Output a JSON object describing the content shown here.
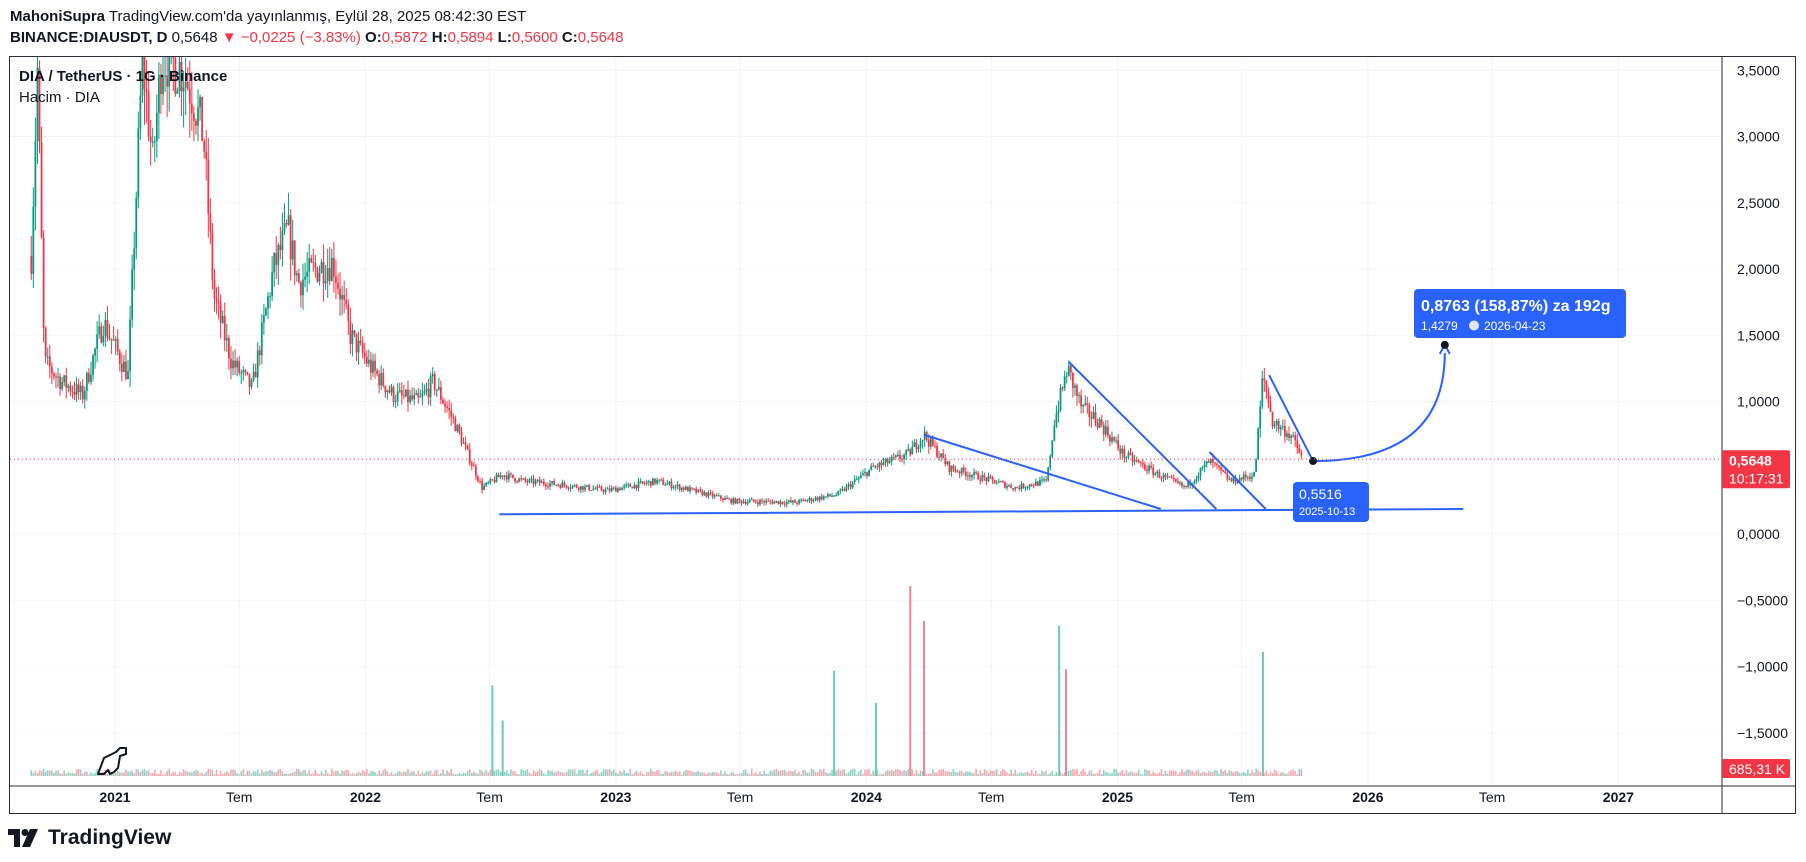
{
  "header": {
    "author": "MahoniSupra",
    "published": "TradingView.com'da yayınlanmış, Eylül 28, 2025 08:42:30 EST",
    "symbol": "BINANCE:DIAUSDT, D",
    "last": "0,5648",
    "change": "−0,0225 (−3.83%)",
    "o_label": "O:",
    "o": "0,5872",
    "h_label": "H:",
    "h": "0,5894",
    "l_label": "L:",
    "l": "0,5600",
    "c_label": "C:",
    "c": "0,5648"
  },
  "legend": {
    "title": "DIA / TetherUS · 1G · Binance",
    "volume": "Hacim · DIA"
  },
  "brand": "TradingView",
  "colors": {
    "up": "#089981",
    "down": "#f23645",
    "drawing": "#2962ff",
    "label_bg": "#2962ff",
    "price_tag": "#f23645"
  },
  "icons": [
    "dinosaur-icon",
    "tradingview-logo-icon",
    "clock-icon"
  ],
  "chart_data": {
    "type": "candlestick",
    "title": "DIA / TetherUS · 1G · Binance",
    "y_axis": {
      "range": [
        -1.9,
        3.6
      ],
      "ticks": [
        {
          "v": 3.5,
          "t": "3,5000"
        },
        {
          "v": 3.0,
          "t": "3,0000"
        },
        {
          "v": 2.5,
          "t": "2,5000"
        },
        {
          "v": 2.0,
          "t": "2,0000"
        },
        {
          "v": 1.5,
          "t": "1,5000"
        },
        {
          "v": 1.0,
          "t": "1,0000"
        },
        {
          "v": 0.0,
          "t": "0,0000"
        },
        {
          "v": -0.5,
          "t": "−0,5000"
        },
        {
          "v": -1.0,
          "t": "−1,0000"
        },
        {
          "v": -1.5,
          "t": "−1,5000"
        }
      ]
    },
    "x_axis": {
      "range": [
        "2020-08-01",
        "2027-06-01"
      ],
      "ticks": [
        {
          "d": "2021-01-01",
          "t": "2021",
          "bold": true
        },
        {
          "d": "2021-07-01",
          "t": "Tem",
          "bold": false
        },
        {
          "d": "2022-01-01",
          "t": "2022",
          "bold": true
        },
        {
          "d": "2022-07-01",
          "t": "Tem",
          "bold": false
        },
        {
          "d": "2023-01-01",
          "t": "2023",
          "bold": true
        },
        {
          "d": "2023-07-01",
          "t": "Tem",
          "bold": false
        },
        {
          "d": "2024-01-01",
          "t": "2024",
          "bold": true
        },
        {
          "d": "2024-07-01",
          "t": "Tem",
          "bold": false
        },
        {
          "d": "2025-01-01",
          "t": "2025",
          "bold": true
        },
        {
          "d": "2025-07-01",
          "t": "Tem",
          "bold": false
        },
        {
          "d": "2026-01-01",
          "t": "2026",
          "bold": true
        },
        {
          "d": "2026-07-01",
          "t": "Tem",
          "bold": false
        },
        {
          "d": "2027-01-01",
          "t": "2027",
          "bold": true
        }
      ]
    },
    "price_path": [
      [
        "2020-09-01",
        2.1
      ],
      [
        "2020-09-10",
        3.5
      ],
      [
        "2020-09-20",
        1.3
      ],
      [
        "2020-10-15",
        1.15
      ],
      [
        "2020-11-15",
        1.05
      ],
      [
        "2020-12-15",
        1.6
      ],
      [
        "2021-01-20",
        1.2
      ],
      [
        "2021-02-10",
        3.6
      ],
      [
        "2021-02-25",
        2.8
      ],
      [
        "2021-03-10",
        3.6
      ],
      [
        "2021-04-10",
        3.5
      ],
      [
        "2021-04-25",
        3.3
      ],
      [
        "2021-05-10",
        3.0
      ],
      [
        "2021-05-25",
        1.8
      ],
      [
        "2021-06-20",
        1.3
      ],
      [
        "2021-07-20",
        1.1
      ],
      [
        "2021-08-20",
        2.0
      ],
      [
        "2021-09-10",
        2.3
      ],
      [
        "2021-09-25",
        1.9
      ],
      [
        "2021-10-20",
        2.0
      ],
      [
        "2021-11-15",
        2.05
      ],
      [
        "2021-12-10",
        1.5
      ],
      [
        "2022-01-10",
        1.25
      ],
      [
        "2022-02-10",
        1.05
      ],
      [
        "2022-03-20",
        1.0
      ],
      [
        "2022-04-10",
        1.15
      ],
      [
        "2022-05-10",
        0.85
      ],
      [
        "2022-06-20",
        0.35
      ],
      [
        "2022-07-20",
        0.45
      ],
      [
        "2022-08-20",
        0.4
      ],
      [
        "2022-10-20",
        0.37
      ],
      [
        "2022-12-20",
        0.33
      ],
      [
        "2023-03-01",
        0.4
      ],
      [
        "2023-06-20",
        0.25
      ],
      [
        "2023-09-20",
        0.24
      ],
      [
        "2023-11-20",
        0.3
      ],
      [
        "2024-01-10",
        0.5
      ],
      [
        "2024-03-01",
        0.6
      ],
      [
        "2024-03-25",
        0.75
      ],
      [
        "2024-05-01",
        0.5
      ],
      [
        "2024-08-05",
        0.35
      ],
      [
        "2024-09-20",
        0.4
      ],
      [
        "2024-10-01",
        0.85
      ],
      [
        "2024-10-20",
        1.25
      ],
      [
        "2024-11-10",
        0.95
      ],
      [
        "2024-12-05",
        0.85
      ],
      [
        "2025-01-10",
        0.6
      ],
      [
        "2025-03-01",
        0.45
      ],
      [
        "2025-04-10",
        0.35
      ],
      [
        "2025-05-15",
        0.55
      ],
      [
        "2025-06-15",
        0.4
      ],
      [
        "2025-07-20",
        0.45
      ],
      [
        "2025-08-01",
        1.2
      ],
      [
        "2025-08-15",
        0.85
      ],
      [
        "2025-09-10",
        0.75
      ],
      [
        "2025-09-28",
        0.5648
      ]
    ],
    "volume": {
      "scale_max": 1300,
      "spikes": [
        {
          "d": "2022-07-05",
          "v": 620,
          "up": true
        },
        {
          "d": "2022-07-20",
          "v": 380,
          "up": true
        },
        {
          "d": "2023-11-15",
          "v": 720,
          "up": true
        },
        {
          "d": "2024-01-15",
          "v": 500,
          "up": true
        },
        {
          "d": "2024-03-05",
          "v": 1300,
          "up": false
        },
        {
          "d": "2024-03-25",
          "v": 1060,
          "up": false
        },
        {
          "d": "2024-10-08",
          "v": 1030,
          "up": true
        },
        {
          "d": "2024-10-18",
          "v": 730,
          "up": false
        },
        {
          "d": "2025-08-01",
          "v": 850,
          "up": true
        }
      ],
      "last_label": "685,31 K"
    },
    "drawings": {
      "support_line": {
        "from": [
          "2022-07-15",
          0.15
        ],
        "to": [
          "2026-05-20",
          0.19
        ]
      },
      "wedge_lines": [
        {
          "from": [
            "2024-03-25",
            0.75
          ],
          "to": [
            "2025-03-05",
            0.19
          ]
        },
        {
          "from": [
            "2024-10-22",
            1.3
          ],
          "to": [
            "2025-05-25",
            0.19
          ]
        },
        {
          "from": [
            "2025-05-15",
            0.62
          ],
          "to": [
            "2025-08-05",
            0.19
          ]
        },
        {
          "from": [
            "2025-08-10",
            1.2
          ],
          "to": [
            "2025-10-13",
            0.5516
          ]
        }
      ],
      "projection": {
        "from": [
          "2025-10-13",
          0.5516
        ],
        "to": [
          "2026-04-23",
          1.4279
        ]
      }
    },
    "measure_label": {
      "main": "0,8763 (158,87%) za 192g",
      "target_price": "1,4279",
      "target_date": "2026-04-23"
    },
    "start_label": {
      "price": "0,5516",
      "date": "2025-10-13"
    },
    "last_price": {
      "value": 0.5648,
      "label": "0,5648",
      "countdown": "10:17:31"
    }
  }
}
